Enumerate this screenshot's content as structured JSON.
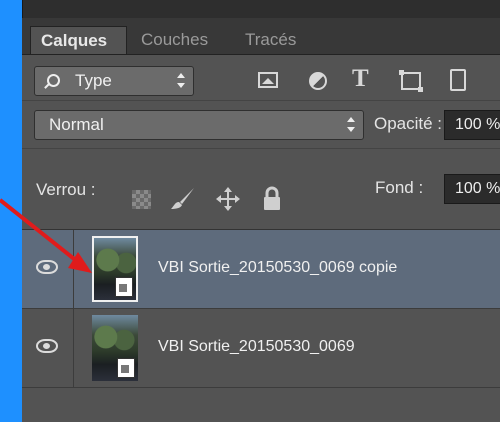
{
  "tabs": [
    {
      "label": "Calques",
      "active": true
    },
    {
      "label": "Couches",
      "active": false
    },
    {
      "label": "Tracés",
      "active": false
    }
  ],
  "filter": {
    "label": "Type"
  },
  "filter_icons": [
    "image-filter-icon",
    "adjustment-filter-icon",
    "type-filter-icon",
    "shape-filter-icon",
    "smart-object-filter-icon"
  ],
  "filter_text_glyph": "T",
  "blend_mode": {
    "value": "Normal"
  },
  "opacity": {
    "label": "Opacité :",
    "value": "100 %"
  },
  "lock": {
    "label": "Verrou :"
  },
  "fill": {
    "label": "Fond :",
    "value": "100 %"
  },
  "layers": [
    {
      "name": "VBI Sortie_20150530_0069 copie",
      "selected": true,
      "visible": true
    },
    {
      "name": "VBI Sortie_20150530_0069",
      "selected": false,
      "visible": true
    }
  ],
  "colors": {
    "accent_frame": "#1e90ff",
    "selected_row": "#5e6b7c",
    "annotation_arrow": "#e01b1b"
  }
}
